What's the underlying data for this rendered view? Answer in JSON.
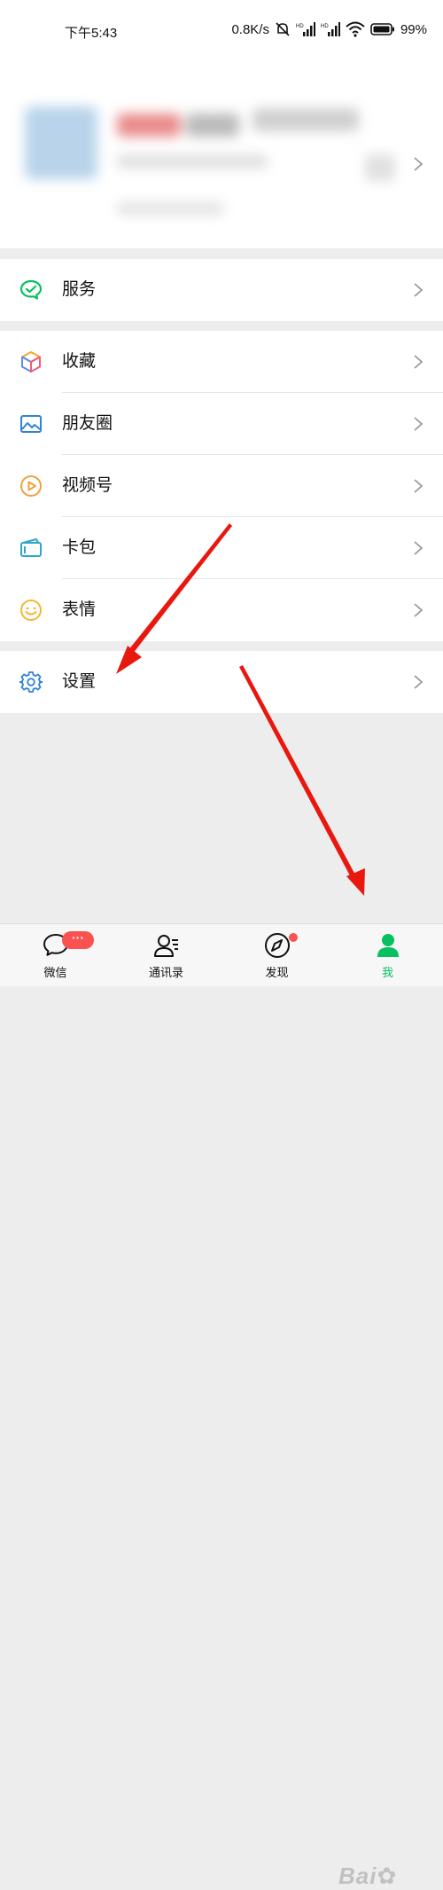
{
  "status_bar": {
    "time": "下午5:43",
    "speed": "0.8K/s",
    "battery": "99%"
  },
  "menu_groups": [
    {
      "items": [
        {
          "label": "服务",
          "icon": "wechat-pay-icon"
        }
      ]
    },
    {
      "items": [
        {
          "label": "收藏",
          "icon": "favorites-cube-icon"
        },
        {
          "label": "朋友圈",
          "icon": "moments-image-icon"
        },
        {
          "label": "视频号",
          "icon": "channels-play-icon"
        },
        {
          "label": "卡包",
          "icon": "card-wallet-icon"
        },
        {
          "label": "表情",
          "icon": "sticker-smile-icon"
        }
      ]
    },
    {
      "items": [
        {
          "label": "设置",
          "icon": "gear-icon"
        }
      ]
    }
  ],
  "tab_bar": {
    "tabs": [
      {
        "label": "微信",
        "icon": "chat-icon",
        "badge": "···"
      },
      {
        "label": "通讯录",
        "icon": "contacts-icon"
      },
      {
        "label": "发现",
        "icon": "compass-icon"
      },
      {
        "label": "我",
        "icon": "me-icon"
      }
    ],
    "active_tab": "我"
  },
  "colors": {
    "accent_green": "#07c160",
    "badge_red": "#fa5151",
    "arrow_red": "#e8180f"
  }
}
